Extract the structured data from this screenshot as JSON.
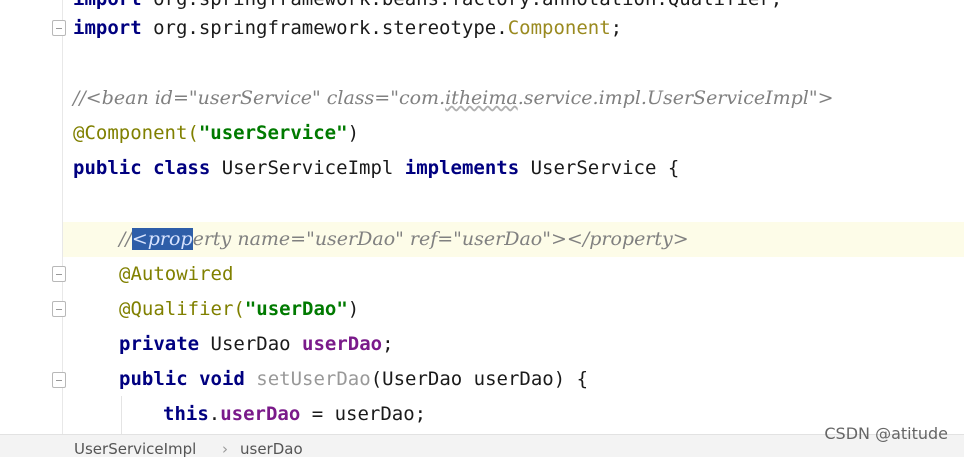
{
  "code_lines": {
    "l0": {
      "kw": "import",
      "rest": " org.springframework.beans.factory.annotation.Qualifier;"
    },
    "l1": {
      "kw": "import",
      "pkg": " org.springframework.stereotype.",
      "cls": "Component",
      "semi": ";"
    },
    "l3": {
      "text": "//<bean id=\"userService\" class=\"com.",
      "sq": "itheima",
      "text2": ".service.impl.UserServiceImpl\">"
    },
    "l4": {
      "ann": "@Component(",
      "str": "\"userService\"",
      "close": ")"
    },
    "l5": {
      "kw1": "public",
      "kw2": "class",
      "name": " UserServiceImpl ",
      "kw3": "implements",
      "rest": " UserService {"
    },
    "l7": {
      "pre": "//",
      "sel": "<prop",
      "rest": "erty name=\"userDao\" ref=\"userDao\"></property>"
    },
    "l8": {
      "ann": "@Autowired"
    },
    "l9": {
      "ann": "@Qualifier(",
      "str": "\"userDao\"",
      "close": ")"
    },
    "l10": {
      "kw": "private",
      "type": " UserDao ",
      "field": "userDao",
      "semi": ";"
    },
    "l11": {
      "kw1": "public",
      "kw2": "void",
      "method": " setUserDao",
      "rest": "(UserDao userDao) {"
    },
    "l12": {
      "kw": "this",
      "dot": ".",
      "field": "userDao",
      "rest": " = userDao;"
    }
  },
  "breadcrumb": {
    "class": "UserServiceImpl",
    "separator": "›",
    "member": "userDao"
  },
  "watermark": "CSDN @atitude"
}
